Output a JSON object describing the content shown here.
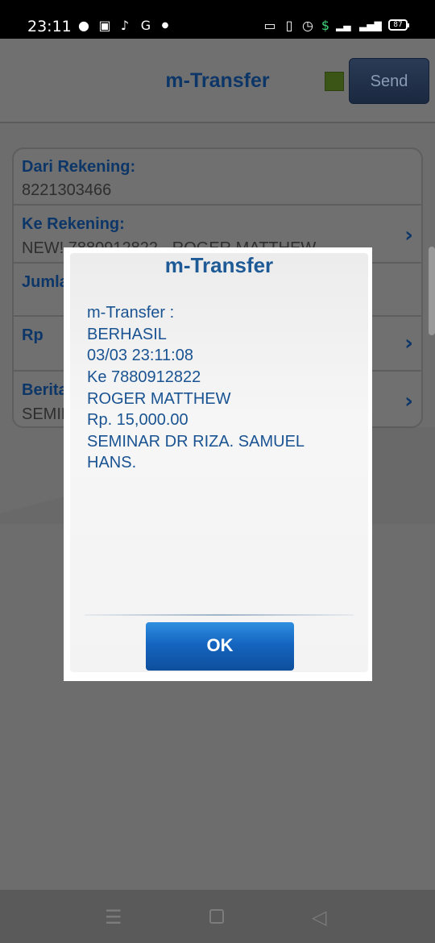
{
  "status_bar": {
    "time": "23:11",
    "battery": "87",
    "left_icons": [
      "line-icon",
      "shopee-icon",
      "tiktok-icon",
      "google-icon",
      "dot-icon"
    ],
    "right_icons": [
      "sim-icon",
      "vibrate-icon",
      "alarm-icon",
      "shield-dollar-icon",
      "signal-icon",
      "4g-signal-icon",
      "battery-icon"
    ]
  },
  "header": {
    "title": "m-Transfer",
    "send_label": "Send",
    "status_color": "#6aa121"
  },
  "form": {
    "rows": [
      {
        "label": "Dari Rekening:",
        "value": "8221303466"
      },
      {
        "label": "Ke Rekening:",
        "value": "NEW! 7880912822 - ROGER MATTHEW"
      },
      {
        "label": "Jumlah",
        "value": ""
      },
      {
        "label": "Rp",
        "value": ""
      },
      {
        "label": "Berita",
        "value": "SEMINAR"
      }
    ]
  },
  "dialog": {
    "title": "m-Transfer",
    "lines": [
      "m-Transfer :",
      "BERHASIL",
      "03/03 23:11:08",
      "Ke 7880912822",
      "ROGER MATTHEW",
      "Rp. 15,000.00",
      "SEMINAR DR RIZA. SAMUEL",
      "HANS."
    ],
    "ok_label": "OK"
  },
  "navbar": {
    "icons": [
      "menu-icon",
      "home-icon",
      "back-icon"
    ]
  }
}
